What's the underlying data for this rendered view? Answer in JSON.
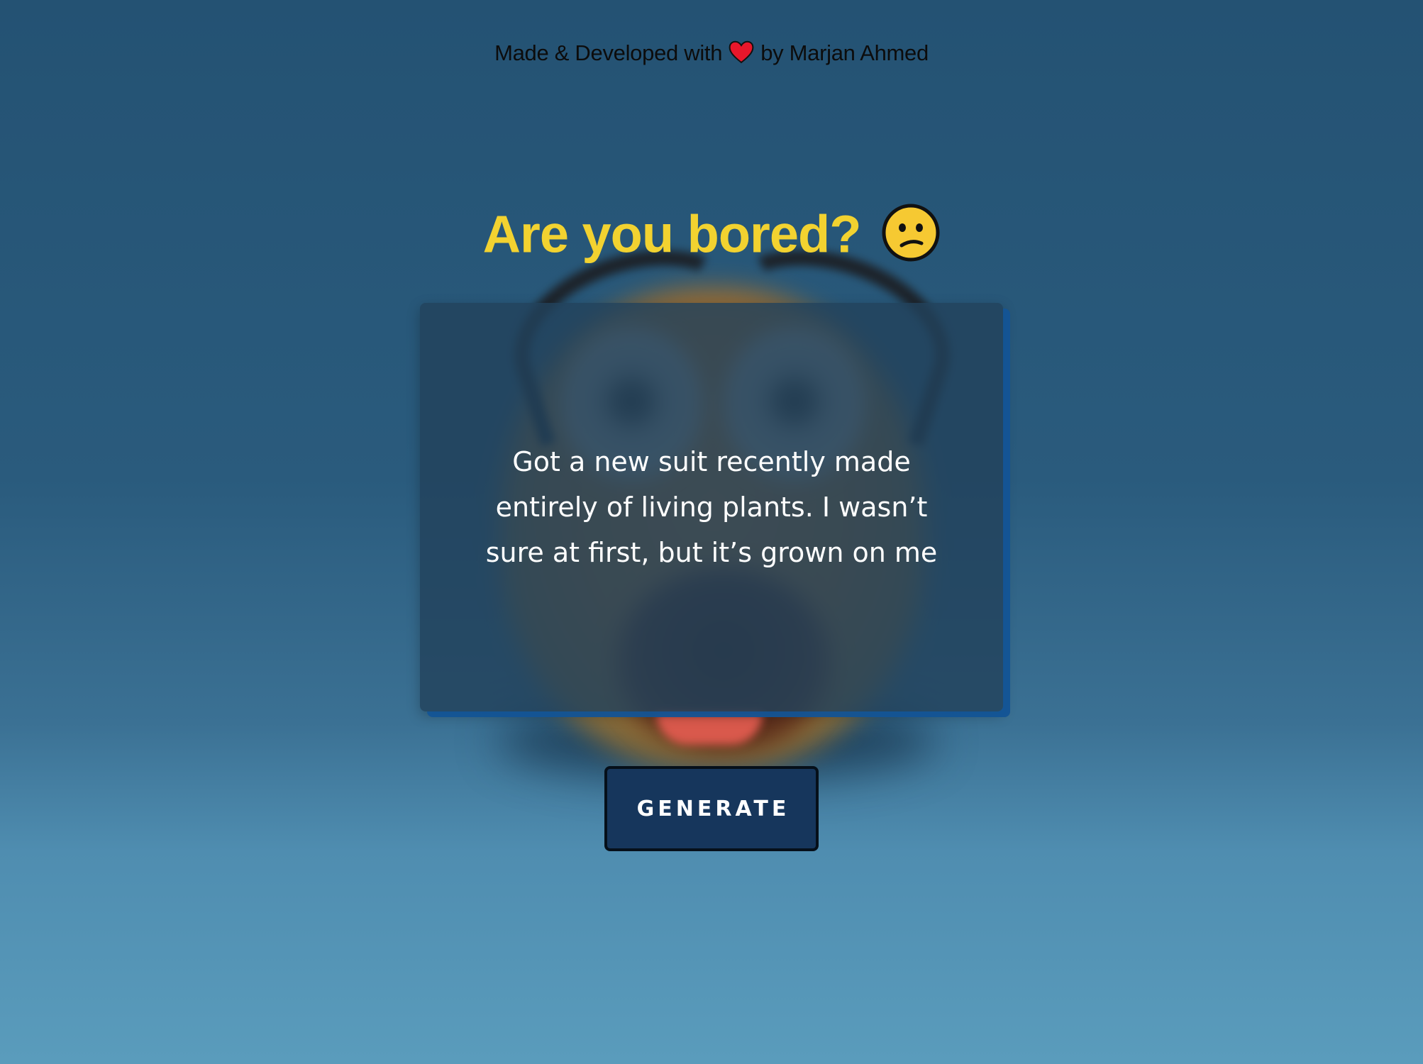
{
  "header": {
    "credit_prefix": "Made & Developed with",
    "credit_suffix": "by Marjan Ahmed",
    "heart_icon": "heart-icon"
  },
  "main": {
    "title": "Are you bored?",
    "title_emoji": "confused-face-icon",
    "joke_text": "Got a new suit recently made entirely of living plants. I wasn’t sure at first, but it’s grown on me",
    "generate_label": "GENERATE"
  },
  "colors": {
    "title": "#f2d230",
    "button_bg": "#16365c",
    "card_accent": "#1354a0"
  }
}
